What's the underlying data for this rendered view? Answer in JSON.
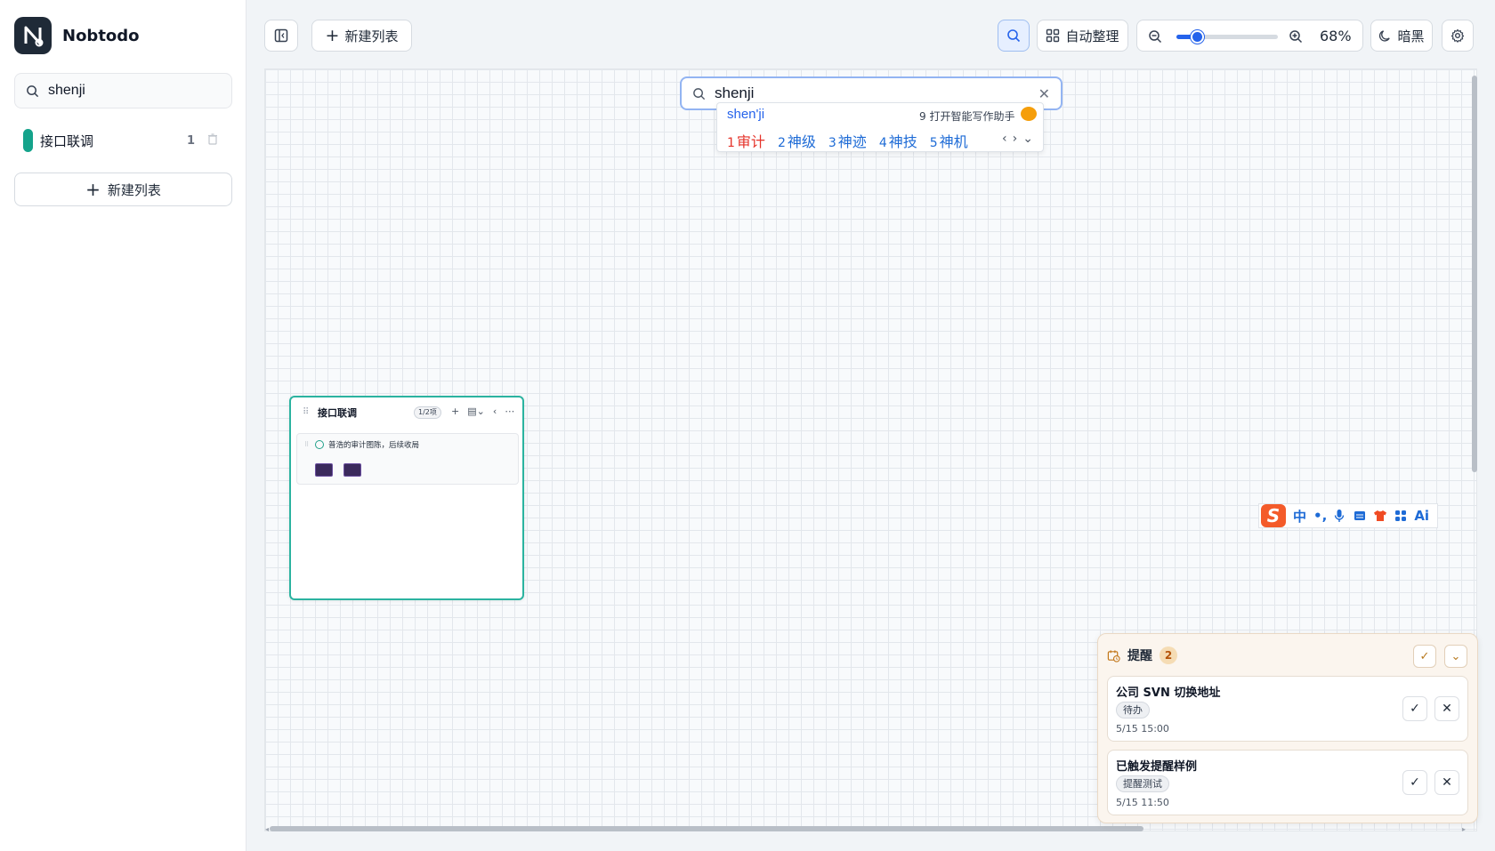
{
  "app": {
    "name": "Nobtodo",
    "logo_letter": "N"
  },
  "sidebar": {
    "search_value": "shenji",
    "lists": [
      {
        "label": "接口联调",
        "count": "1",
        "color": "#14a38b"
      }
    ],
    "new_list_label": "新建列表"
  },
  "toolbar": {
    "new_list_label": "新建列表",
    "auto_arrange_label": "自动整理",
    "zoom_percent_label": "68%",
    "zoom_level": 0.2,
    "dark_label": "暗黑"
  },
  "canvas_search": {
    "query": "shenji",
    "ime": {
      "pinyin": "shen'ji",
      "hint": "9 打开智能写作助手",
      "candidates": [
        {
          "n": "1",
          "text": "审计"
        },
        {
          "n": "2",
          "text": "神级"
        },
        {
          "n": "3",
          "text": "神迹"
        },
        {
          "n": "4",
          "text": "神技"
        },
        {
          "n": "5",
          "text": "神机"
        }
      ]
    }
  },
  "list_card": {
    "title": "接口联调",
    "badge": "1/2项",
    "tasks": [
      {
        "text": "普浩的审计图陈，后续收局",
        "images": 2
      }
    ]
  },
  "sogou_toolbar": {
    "logo": "S",
    "mode": "中",
    "punct": "•,",
    "ai": "Ai"
  },
  "reminders": {
    "title": "提醒",
    "count": "2",
    "items": [
      {
        "title": "公司 SVN 切换地址",
        "tag": "待办",
        "time": "5/15 15:00"
      },
      {
        "title": "已触发提醒样例",
        "tag": "提醒测试",
        "time": "5/15 11:50"
      }
    ]
  },
  "colors": {
    "accent": "#2563eb",
    "list_green": "#14a38b",
    "reminder_bg": "#fbf5ee"
  }
}
